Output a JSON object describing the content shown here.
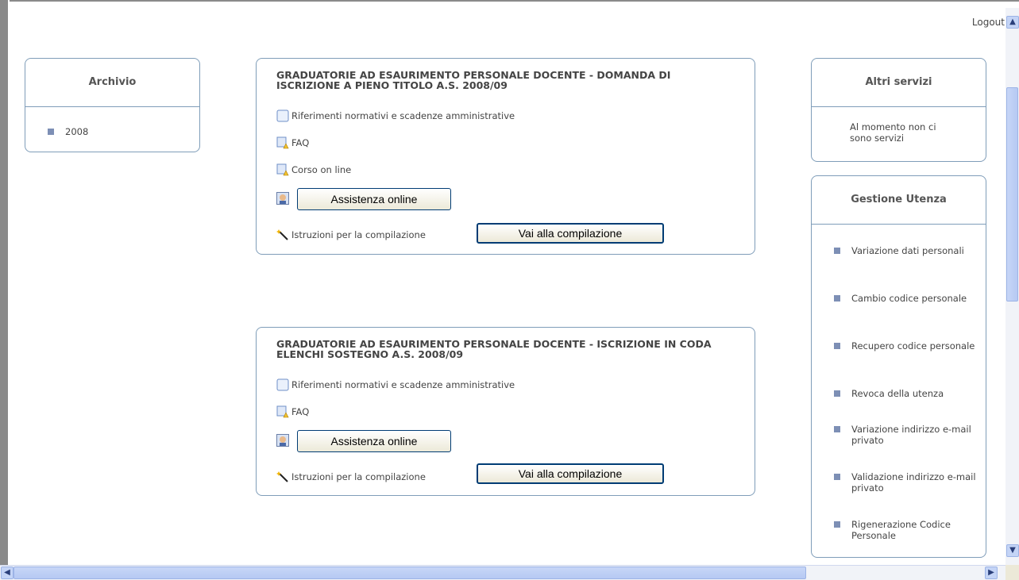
{
  "header": {
    "logout_label": "Logout"
  },
  "archivio": {
    "title": "Archivio",
    "items": [
      {
        "label": "2008"
      }
    ]
  },
  "cards": [
    {
      "title": "GRADUATORIE AD ESAURIMENTO PERSONALE DOCENTE - DOMANDA DI ISCRIZIONE A PIENO TITOLO A.S. 2008/09",
      "riferimenti": "Riferimenti normativi e scadenze amministrative",
      "faq": "FAQ",
      "corso": "Corso on line",
      "assistenza": "Assistenza online",
      "istruzioni": "Istruzioni per la compilazione",
      "compila": "Vai alla compilazione"
    },
    {
      "title": "GRADUATORIE AD ESAURIMENTO PERSONALE DOCENTE - ISCRIZIONE IN CODA ELENCHI SOSTEGNO A.S. 2008/09",
      "riferimenti": "Riferimenti normativi e scadenze amministrative",
      "faq": "FAQ",
      "assistenza": "Assistenza online",
      "istruzioni": "Istruzioni per la compilazione",
      "compila": "Vai alla compilazione"
    }
  ],
  "altri_servizi": {
    "title": "Altri servizi",
    "message": "Al momento non ci sono servizi"
  },
  "gestione_utenza": {
    "title": "Gestione Utenza",
    "items": [
      {
        "label": "Variazione dati personali"
      },
      {
        "label": "Cambio codice personale"
      },
      {
        "label": "Recupero codice personale"
      },
      {
        "label": "Revoca della utenza"
      },
      {
        "label": "Variazione indirizzo e-mail privato"
      },
      {
        "label": "Validazione indirizzo e-mail privato"
      },
      {
        "label": "Rigenerazione Codice Personale"
      }
    ]
  },
  "colors": {
    "border": "#7f9db9",
    "bullet": "#7d8fb5",
    "scroll": "#c4d4f6"
  },
  "icons": {
    "doc": "document-icon",
    "warn": "document-warning-icon",
    "person": "person-support-icon",
    "wand": "magic-wand-icon"
  }
}
